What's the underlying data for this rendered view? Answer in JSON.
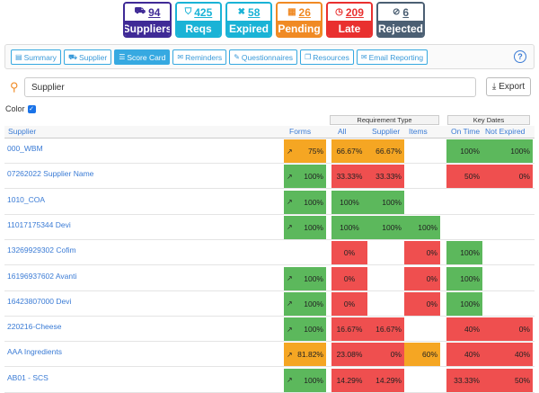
{
  "stats": [
    {
      "icon": "truck-icon",
      "glyph": "⛟",
      "count": "94",
      "label": "Suppliers",
      "color": "#3f2a96"
    },
    {
      "icon": "shield-icon",
      "glyph": "⛉",
      "count": "425",
      "label": "Reqs",
      "color": "#1ab3d6"
    },
    {
      "icon": "close-icon",
      "glyph": "✖",
      "count": "58",
      "label": "Expired",
      "color": "#1ab3d6"
    },
    {
      "icon": "calendar-icon",
      "glyph": "▦",
      "count": "26",
      "label": "Pending",
      "color": "#f08a24"
    },
    {
      "icon": "clock-icon",
      "glyph": "◷",
      "count": "209",
      "label": "Late",
      "color": "#e9302f"
    },
    {
      "icon": "block-icon",
      "glyph": "⊘",
      "count": "6",
      "label": "Rejected",
      "color": "#4b5f73"
    }
  ],
  "tabs": [
    {
      "label": "Summary",
      "icon": "table-icon",
      "glyph": "▤"
    },
    {
      "label": "Supplier",
      "icon": "truck-icon",
      "glyph": "⛟"
    },
    {
      "label": "Score Card",
      "icon": "list-icon",
      "glyph": "☰",
      "active": true
    },
    {
      "label": "Reminders",
      "icon": "envelope-icon",
      "glyph": "✉"
    },
    {
      "label": "Questionnaires",
      "icon": "edit-icon",
      "glyph": "✎"
    },
    {
      "label": "Resources",
      "icon": "book-icon",
      "glyph": "❐"
    },
    {
      "label": "Email Reporting",
      "icon": "envelope-icon",
      "glyph": "✉"
    }
  ],
  "help_glyph": "?",
  "search": {
    "value": "Supplier",
    "icon": "search-icon"
  },
  "export_label": "Export",
  "color_toggle": {
    "label": "Color",
    "checked": true
  },
  "table": {
    "group_headers": {
      "requirement_type": "Requirement Type",
      "key_dates": "Key Dates"
    },
    "columns": {
      "supplier": "Supplier",
      "forms": "Forms",
      "all": "All",
      "supplier_req": "Supplier",
      "items": "Items",
      "on_time": "On Time",
      "not_expired": "Not Expired"
    },
    "status_colors": {
      "green": "#5cb85c",
      "red": "#ef4f4f",
      "orange": "#f5a623"
    },
    "rows": [
      {
        "name": "000_WBM",
        "forms": "75%",
        "forms_c": "o",
        "all": "66.67%",
        "all_c": "o",
        "sup": "66.67%",
        "sup_c": "o",
        "items": "",
        "items_c": "",
        "on": "100%",
        "on_c": "g",
        "exp": "100%",
        "exp_c": "g"
      },
      {
        "name": "07262022 Supplier Name",
        "forms": "100%",
        "forms_c": "g",
        "all": "33.33%",
        "all_c": "r",
        "sup": "33.33%",
        "sup_c": "r",
        "items": "",
        "items_c": "",
        "on": "50%",
        "on_c": "r",
        "exp": "0%",
        "exp_c": "r"
      },
      {
        "name": "1010_COA",
        "forms": "100%",
        "forms_c": "g",
        "all": "100%",
        "all_c": "g",
        "sup": "100%",
        "sup_c": "g",
        "items": "",
        "items_c": "",
        "on": "",
        "on_c": "",
        "exp": "",
        "exp_c": ""
      },
      {
        "name": "11017175344 Devi",
        "forms": "100%",
        "forms_c": "g",
        "all": "100%",
        "all_c": "g",
        "sup": "100%",
        "sup_c": "g",
        "items": "100%",
        "items_c": "g",
        "on": "",
        "on_c": "",
        "exp": "",
        "exp_c": ""
      },
      {
        "name": "13269929302 Cofim",
        "forms": "",
        "forms_c": "",
        "all": "0%",
        "all_c": "r",
        "sup": "",
        "sup_c": "",
        "items": "0%",
        "items_c": "r",
        "on": "100%",
        "on_c": "g",
        "exp": "",
        "exp_c": ""
      },
      {
        "name": "16196937602 Avanti",
        "forms": "100%",
        "forms_c": "g",
        "all": "0%",
        "all_c": "r",
        "sup": "",
        "sup_c": "",
        "items": "0%",
        "items_c": "r",
        "on": "100%",
        "on_c": "g",
        "exp": "",
        "exp_c": ""
      },
      {
        "name": "16423807000 Devi",
        "forms": "100%",
        "forms_c": "g",
        "all": "0%",
        "all_c": "r",
        "sup": "",
        "sup_c": "",
        "items": "0%",
        "items_c": "r",
        "on": "100%",
        "on_c": "g",
        "exp": "",
        "exp_c": ""
      },
      {
        "name": "220216-Cheese",
        "forms": "100%",
        "forms_c": "g",
        "all": "16.67%",
        "all_c": "r",
        "sup": "16.67%",
        "sup_c": "r",
        "items": "",
        "items_c": "",
        "on": "40%",
        "on_c": "r",
        "exp": "0%",
        "exp_c": "r"
      },
      {
        "name": "AAA Ingredients",
        "forms": "81.82%",
        "forms_c": "o",
        "all": "23.08%",
        "all_c": "r",
        "sup": "0%",
        "sup_c": "r",
        "items": "60%",
        "items_c": "o",
        "on": "40%",
        "on_c": "r",
        "exp": "40%",
        "exp_c": "r"
      },
      {
        "name": "AB01 - SCS",
        "forms": "100%",
        "forms_c": "g",
        "all": "14.29%",
        "all_c": "r",
        "sup": "14.29%",
        "sup_c": "r",
        "items": "",
        "items_c": "",
        "on": "33.33%",
        "on_c": "r",
        "exp": "50%",
        "exp_c": "r"
      }
    ]
  }
}
